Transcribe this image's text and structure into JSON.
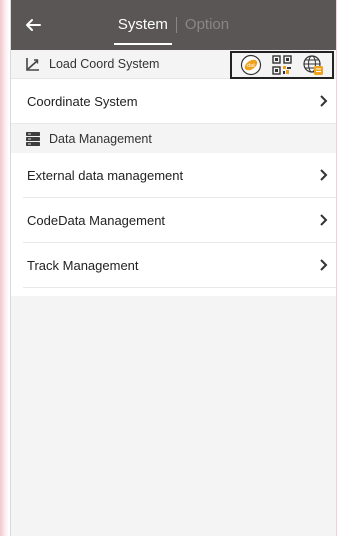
{
  "header": {
    "tabs": [
      {
        "label": "System",
        "active": true
      },
      {
        "label": "Option",
        "active": false
      }
    ],
    "back_icon": "arrow-left-icon"
  },
  "sections": {
    "load_coord": {
      "label": "Load Coord System",
      "icon": "axis-icon",
      "quick_icons": [
        "coordinate-file-icon",
        "qr-code-icon",
        "globe-import-icon"
      ]
    },
    "data_management": {
      "label": "Data Management",
      "icon": "database-icon"
    }
  },
  "rows": {
    "coordinate_system": "Coordinate System",
    "external_data": "External data management",
    "codedata": "CodeData Management",
    "track": "Track Management"
  },
  "colors": {
    "topbar": "#5a5656",
    "accent_orange": "#f0a21c",
    "section_bg": "#f4f4f4"
  }
}
